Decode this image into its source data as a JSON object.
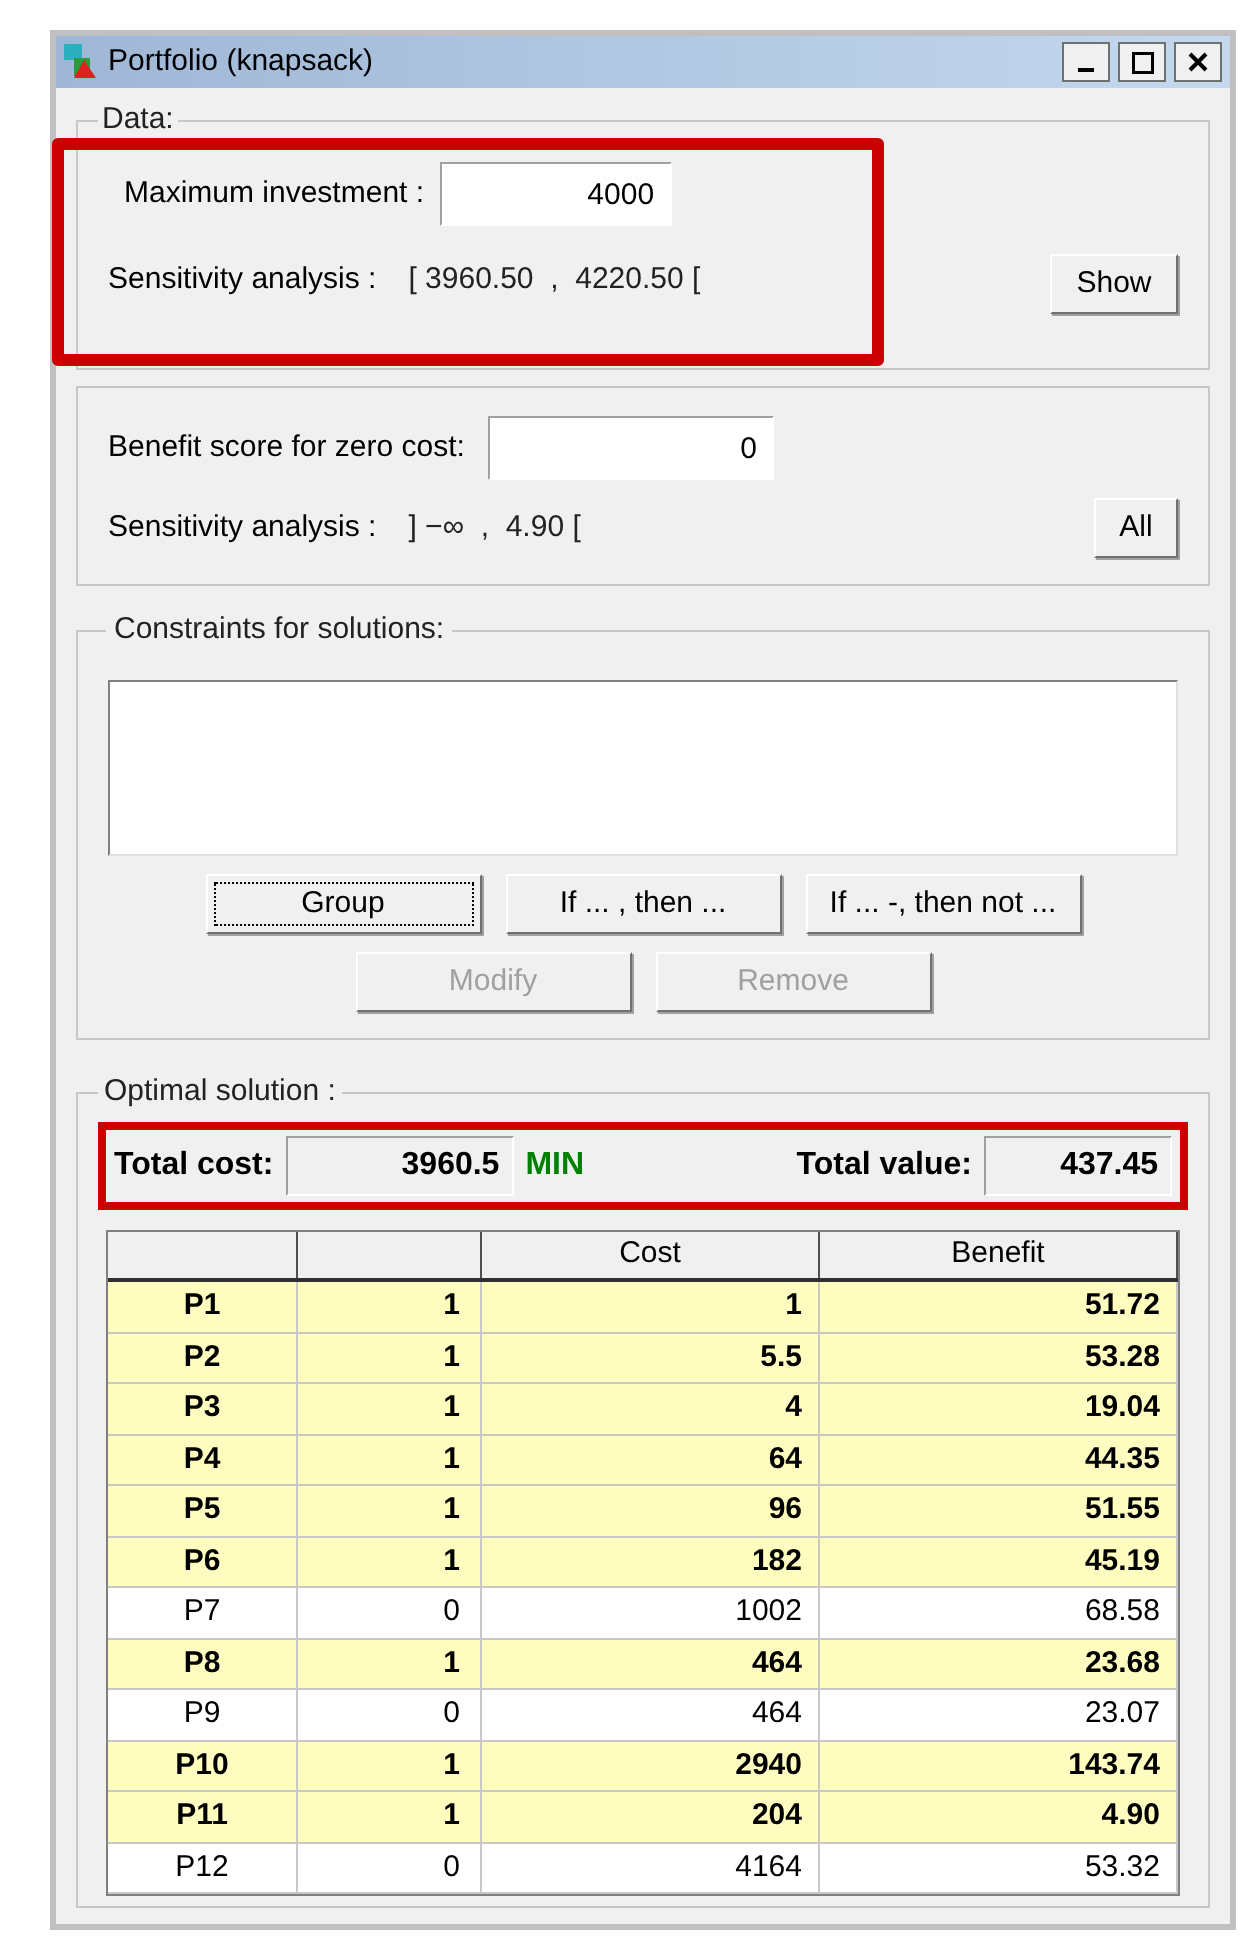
{
  "window": {
    "title": "Portfolio (knapsack)"
  },
  "data": {
    "legend": "Data:",
    "highlighted": true,
    "max_investment_label": "Maximum investment :",
    "max_investment": "4000",
    "sensitivity_label": "Sensitivity analysis :",
    "sensitivity": "[ 3960.50  ,  4220.50 [",
    "button": "Show"
  },
  "benefit": {
    "label": "Benefit score for zero cost:",
    "value": "0",
    "sensitivity_label": "Sensitivity analysis :",
    "sensitivity": "] −∞  ,  4.90 [",
    "button": "All"
  },
  "constraints": {
    "legend": "Constraints for solutions:",
    "buttons": [
      {
        "label": "Group",
        "disabled": false,
        "focused": true
      },
      {
        "label": "If ... , then ...",
        "disabled": false,
        "focused": false
      },
      {
        "label": "If ... -, then not ...",
        "disabled": false,
        "focused": false
      }
    ],
    "buttons_row_2": [
      {
        "label": "Modify",
        "disabled": true,
        "focused": false
      },
      {
        "label": "Remove",
        "disabled": true,
        "focused": false
      }
    ]
  },
  "solution": {
    "legend": "Optimal solution :",
    "highlighted": true,
    "total_cost_label": "Total cost:",
    "total_cost": "3960.5",
    "min_label": "MIN",
    "total_value_label": "Total value:",
    "total_value": "437.45",
    "columns": [
      "",
      "",
      "Cost",
      "Benefit"
    ],
    "rows": [
      {
        "name": "P1",
        "chosen": "1",
        "cost": "1",
        "benefit": "51.72",
        "selected": true
      },
      {
        "name": "P2",
        "chosen": "1",
        "cost": "5.5",
        "benefit": "53.28",
        "selected": true
      },
      {
        "name": "P3",
        "chosen": "1",
        "cost": "4",
        "benefit": "19.04",
        "selected": true
      },
      {
        "name": "P4",
        "chosen": "1",
        "cost": "64",
        "benefit": "44.35",
        "selected": true
      },
      {
        "name": "P5",
        "chosen": "1",
        "cost": "96",
        "benefit": "51.55",
        "selected": true
      },
      {
        "name": "P6",
        "chosen": "1",
        "cost": "182",
        "benefit": "45.19",
        "selected": true
      },
      {
        "name": "P7",
        "chosen": "0",
        "cost": "1002",
        "benefit": "68.58",
        "selected": false
      },
      {
        "name": "P8",
        "chosen": "1",
        "cost": "464",
        "benefit": "23.68",
        "selected": true
      },
      {
        "name": "P9",
        "chosen": "0",
        "cost": "464",
        "benefit": "23.07",
        "selected": false
      },
      {
        "name": "P10",
        "chosen": "1",
        "cost": "2940",
        "benefit": "143.74",
        "selected": true
      },
      {
        "name": "P11",
        "chosen": "1",
        "cost": "204",
        "benefit": "4.90",
        "selected": true
      },
      {
        "name": "P12",
        "chosen": "0",
        "cost": "4164",
        "benefit": "53.32",
        "selected": false
      }
    ]
  }
}
